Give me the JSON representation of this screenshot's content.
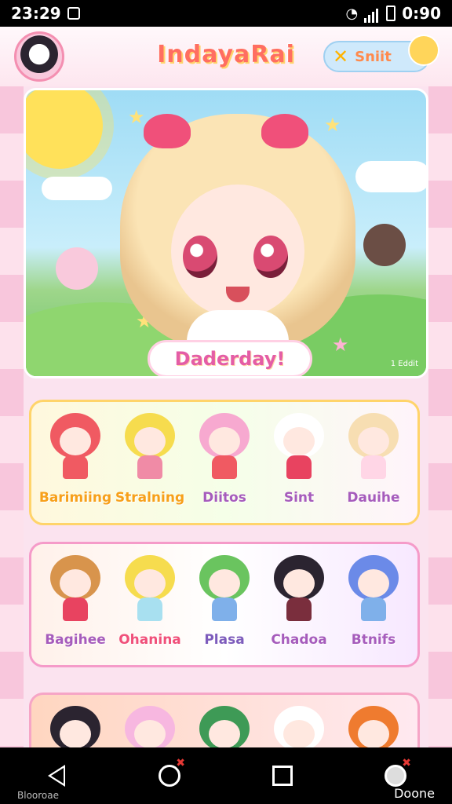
{
  "status_bar": {
    "time": "23:29",
    "battery_time": "0:90"
  },
  "header": {
    "title": "IndayaRai",
    "button_label": "Sniit"
  },
  "hero": {
    "bubble_text": "Daderday!",
    "corner_mark": "1 Eddit"
  },
  "colors": {
    "accent": "#ff6e61",
    "pink": "#f0507a",
    "sky": "#9fdcf5",
    "yellow": "#ffd46a"
  },
  "rows": [
    {
      "items": [
        {
          "label": "Barimiing",
          "label_color": "#f7a01a",
          "hair": "#f05a62",
          "dress": "#f05a62"
        },
        {
          "label": "Stralning",
          "label_color": "#f7a01a",
          "hair": "#f6dc4e",
          "dress": "#f08ba6"
        },
        {
          "label": "Diitos",
          "label_color": "#a65cbc",
          "hair": "#f7a9d0",
          "dress": "#f05a62"
        },
        {
          "label": "Sint",
          "label_color": "#a65cbc",
          "hair": "#ffffff",
          "dress": "#e84360"
        },
        {
          "label": "Dauihe",
          "label_color": "#a65cbc",
          "hair": "#f7deb2",
          "dress": "#ffd6e6"
        }
      ]
    },
    {
      "items": [
        {
          "label": "Bagihee",
          "label_color": "#a65cbc",
          "hair": "#d8944c",
          "dress": "#e84360"
        },
        {
          "label": "Ohanina",
          "label_color": "#f0507a",
          "hair": "#f6dc4e",
          "dress": "#a8e0f0"
        },
        {
          "label": "Plasa",
          "label_color": "#7d5cbc",
          "hair": "#6ac45f",
          "dress": "#7fb0ea"
        },
        {
          "label": "Chadoa",
          "label_color": "#a65cbc",
          "hair": "#2b2430",
          "dress": "#7a2e3d"
        },
        {
          "label": "Btnifs",
          "label_color": "#a65cbc",
          "hair": "#6b8ae8",
          "dress": "#7fb0ea"
        }
      ]
    },
    {
      "items": [
        {
          "label": "",
          "label_color": "#a65cbc",
          "hair": "#2b2430",
          "dress": "#e84360"
        },
        {
          "label": "",
          "label_color": "#a65cbc",
          "hair": "#f7b7e0",
          "dress": "#ffffff"
        },
        {
          "label": "",
          "label_color": "#a65cbc",
          "hair": "#3e9a56",
          "dress": "#ffffff"
        },
        {
          "label": "",
          "label_color": "#a65cbc",
          "hair": "#ffffff",
          "dress": "#ffffff"
        },
        {
          "label": "",
          "label_color": "#a65cbc",
          "hair": "#ef7b2f",
          "dress": "#ffffff"
        }
      ]
    }
  ],
  "nav": {
    "left_caption": "Blooroae",
    "right_caption": "Doone"
  }
}
